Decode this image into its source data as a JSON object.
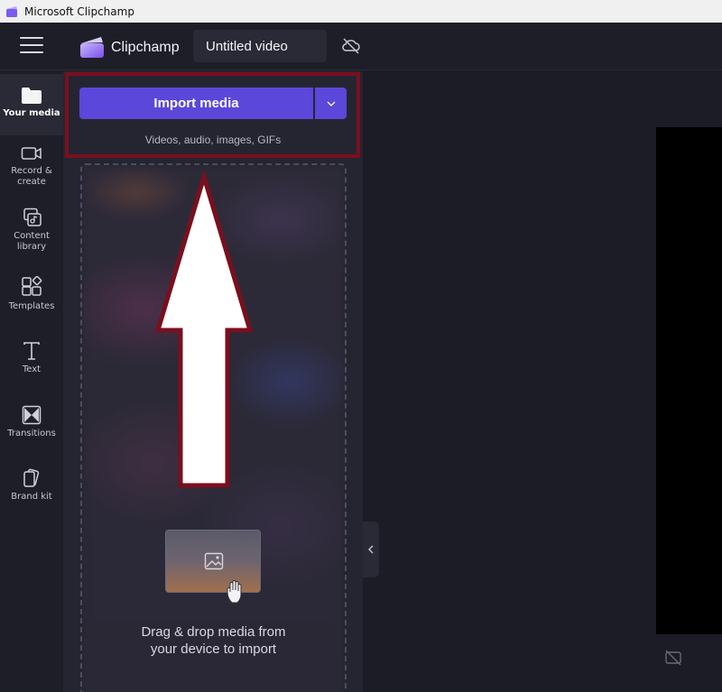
{
  "window": {
    "title": "Microsoft Clipchamp"
  },
  "header": {
    "brand": "Clipchamp",
    "video_title": "Untitled video",
    "icons": {
      "menu": "hamburger-icon",
      "logo": "clipchamp-logo-icon",
      "cloud": "cloud-off-icon"
    }
  },
  "sidebar": {
    "items": [
      {
        "label": "Your media",
        "icon": "folder-icon",
        "active": true
      },
      {
        "label": "Record & create",
        "icon": "camera-icon"
      },
      {
        "label": "Content library",
        "icon": "library-icon"
      },
      {
        "label": "Templates",
        "icon": "templates-icon"
      },
      {
        "label": "Text",
        "icon": "text-icon"
      },
      {
        "label": "Transitions",
        "icon": "transitions-icon"
      },
      {
        "label": "Brand kit",
        "icon": "brand-kit-icon"
      }
    ]
  },
  "media_panel": {
    "import_button": "Import media",
    "import_hint": "Videos, audio, images, GIFs",
    "drop_text_line1": "Drag & drop media from",
    "drop_text_line2": "your device to import"
  },
  "colors": {
    "accent": "#5b47d9",
    "highlight": "#7a0f1e",
    "panel": "#252531"
  }
}
